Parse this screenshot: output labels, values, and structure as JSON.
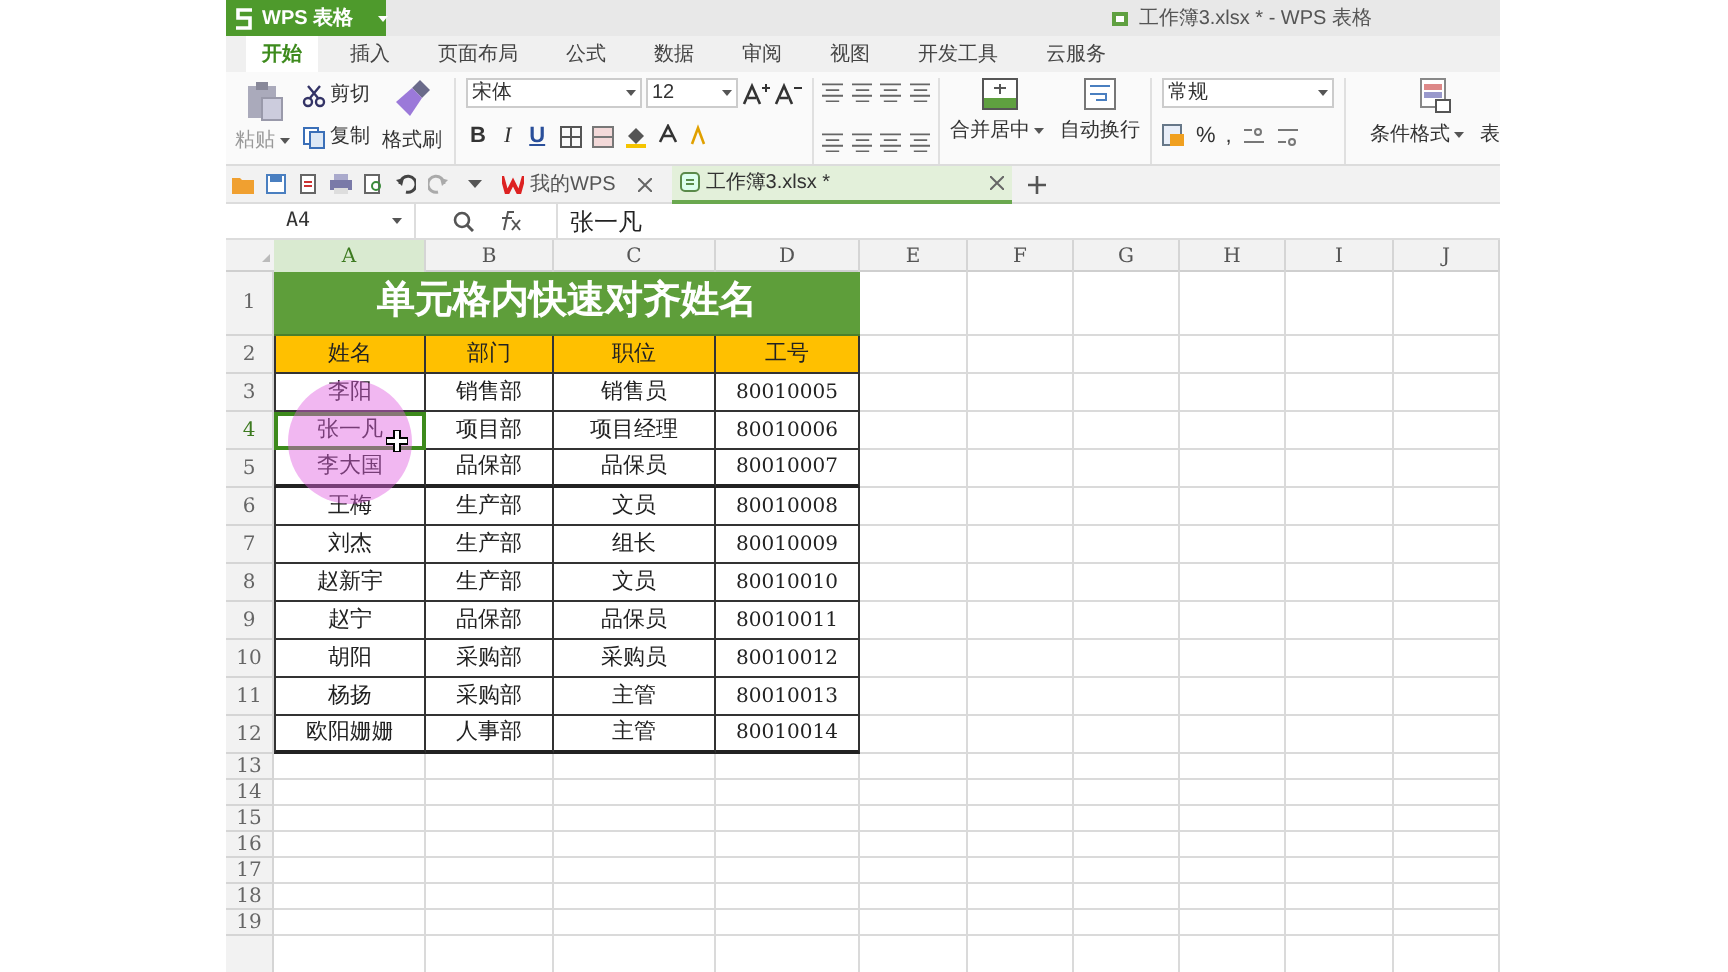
{
  "app": {
    "logo": "WPS 表格"
  },
  "window": {
    "title": "工作簿3.xlsx * - WPS 表格"
  },
  "ribbon_tabs": [
    {
      "label": "开始",
      "selected": true
    },
    {
      "label": "插入",
      "selected": false
    },
    {
      "label": "页面布局",
      "selected": false
    },
    {
      "label": "公式",
      "selected": false
    },
    {
      "label": "数据",
      "selected": false
    },
    {
      "label": "审阅",
      "selected": false
    },
    {
      "label": "视图",
      "selected": false
    },
    {
      "label": "开发工具",
      "selected": false
    },
    {
      "label": "云服务",
      "selected": false
    }
  ],
  "ribbon": {
    "paste": "粘贴",
    "cut": "剪切",
    "copy": "复制",
    "format_painter": "格式刷",
    "font_name": "宋体",
    "font_size": "12",
    "bold": "B",
    "italic": "I",
    "underline": "U",
    "merge": "合并居中",
    "wrap": "自动换行",
    "number_format": "常规",
    "percent": "%",
    "comma": ",",
    "conditional": "条件格式",
    "table": "表"
  },
  "doc_tabs": [
    {
      "label": "我的WPS",
      "selected": false
    },
    {
      "label": "工作簿3.xlsx *",
      "selected": true
    }
  ],
  "formula_bar": {
    "name_box": "A4",
    "value": "张一凡"
  },
  "sheet": {
    "columns": [
      {
        "label": "A",
        "selected": true
      },
      {
        "label": "B",
        "selected": false
      },
      {
        "label": "C",
        "selected": false
      },
      {
        "label": "D",
        "selected": false
      },
      {
        "label": "E",
        "selected": false
      },
      {
        "label": "F",
        "selected": false
      },
      {
        "label": "G",
        "selected": false
      },
      {
        "label": "H",
        "selected": false
      },
      {
        "label": "I",
        "selected": false
      },
      {
        "label": "J",
        "selected": false
      }
    ],
    "rows": [
      {
        "label": "1",
        "kind": "title",
        "selected": false,
        "cells": [
          "单元格内快速对齐姓名"
        ]
      },
      {
        "label": "2",
        "kind": "header",
        "selected": false,
        "cells": [
          "姓名",
          "部门",
          "职位",
          "工号"
        ]
      },
      {
        "label": "3",
        "kind": "data",
        "selected": false,
        "cells": [
          "李阳",
          "销售部",
          "销售员",
          "80010005"
        ]
      },
      {
        "label": "4",
        "kind": "data",
        "selected": true,
        "cells": [
          "张一凡",
          "项目部",
          "项目经理",
          "80010006"
        ]
      },
      {
        "label": "5",
        "kind": "data",
        "selected": false,
        "thick_border": true,
        "cells": [
          "李大国",
          "品保部",
          "品保员",
          "80010007"
        ]
      },
      {
        "label": "6",
        "kind": "data",
        "selected": false,
        "cells": [
          "王梅",
          "生产部",
          "文员",
          "80010008"
        ]
      },
      {
        "label": "7",
        "kind": "data",
        "selected": false,
        "cells": [
          "刘杰",
          "生产部",
          "组长",
          "80010009"
        ]
      },
      {
        "label": "8",
        "kind": "data",
        "selected": false,
        "cells": [
          "赵新宇",
          "生产部",
          "文员",
          "80010010"
        ]
      },
      {
        "label": "9",
        "kind": "data",
        "selected": false,
        "cells": [
          "赵宁",
          "品保部",
          "品保员",
          "80010011"
        ]
      },
      {
        "label": "10",
        "kind": "data",
        "selected": false,
        "cells": [
          "胡阳",
          "采购部",
          "采购员",
          "80010012"
        ]
      },
      {
        "label": "11",
        "kind": "data",
        "selected": false,
        "cells": [
          "杨扬",
          "采购部",
          "主管",
          "80010013"
        ]
      },
      {
        "label": "12",
        "kind": "data",
        "selected": false,
        "thick_border": true,
        "cells": [
          "欧阳姗姗",
          "人事部",
          "主管",
          "80010014"
        ]
      },
      {
        "label": "13",
        "kind": "empty",
        "selected": false,
        "cells": []
      },
      {
        "label": "14",
        "kind": "empty",
        "selected": false,
        "cells": []
      },
      {
        "label": "15",
        "kind": "empty",
        "selected": false,
        "cells": []
      },
      {
        "label": "16",
        "kind": "empty",
        "selected": false,
        "cells": []
      },
      {
        "label": "17",
        "kind": "empty",
        "selected": false,
        "cells": []
      },
      {
        "label": "18",
        "kind": "empty",
        "selected": false,
        "cells": []
      },
      {
        "label": "19",
        "kind": "empty",
        "selected": false,
        "cells": []
      }
    ]
  }
}
